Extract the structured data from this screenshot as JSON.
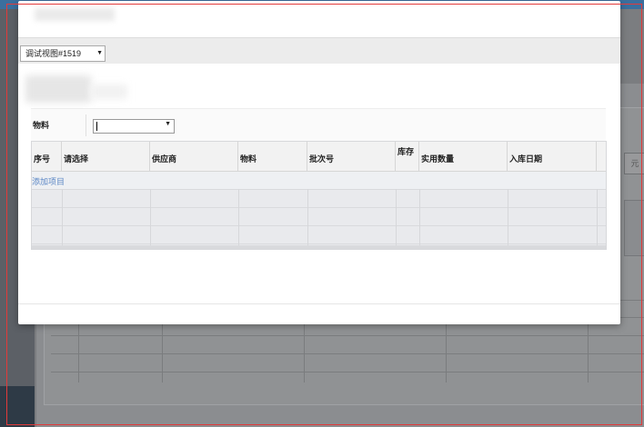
{
  "background": {
    "right_button_text": "元"
  },
  "modal": {
    "view_selector": {
      "value": "调试视图#1519"
    },
    "form": {
      "material_label": "物料",
      "material_value": ""
    },
    "table": {
      "columns": [
        "序号",
        "请选择",
        "供应商",
        "物料",
        "批次号",
        "库存",
        "实用数量",
        "入库日期"
      ],
      "add_link": "添加项目"
    }
  }
}
